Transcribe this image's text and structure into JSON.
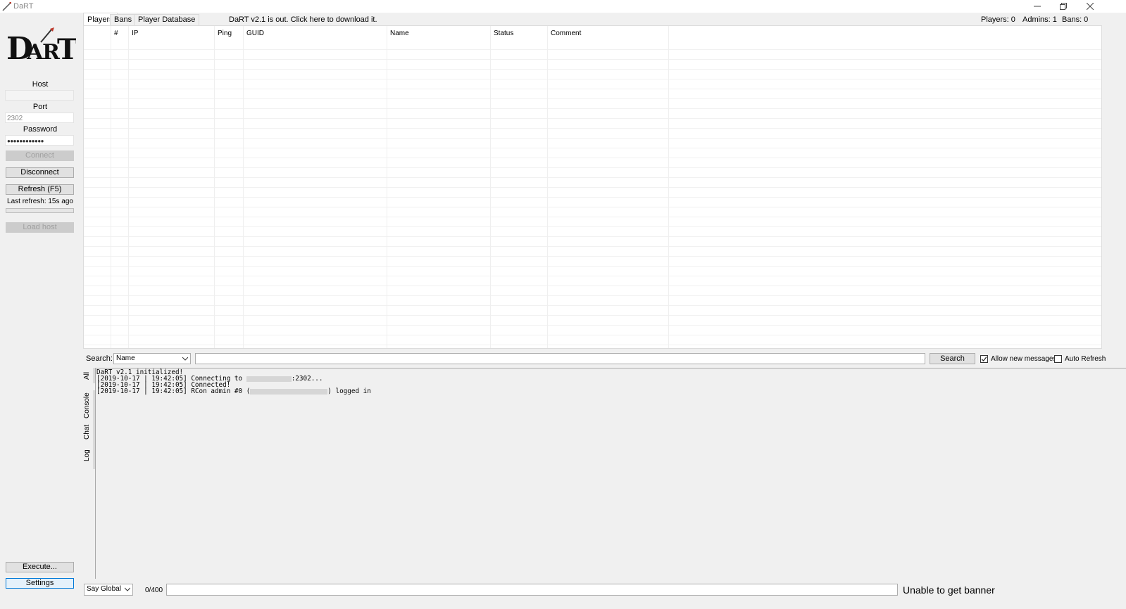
{
  "window": {
    "title": "DaRT"
  },
  "left_panel": {
    "host_label": "Host",
    "host_value": "",
    "port_label": "Port",
    "port_value": "2302",
    "password_label": "Password",
    "password_value": "●●●●●●●●●●●●",
    "connect_label": "Connect",
    "disconnect_label": "Disconnect",
    "refresh_label": "Refresh (F5)",
    "last_refresh": "Last refresh: 15s ago",
    "load_host_label": "Load host",
    "execute_label": "Execute...",
    "settings_label": "Settings"
  },
  "tabs": [
    {
      "label": "Players",
      "active": true
    },
    {
      "label": "Bans",
      "active": false
    },
    {
      "label": "Player Database",
      "active": false
    }
  ],
  "update_notice": "DaRT v2.1 is out. Click here to download it.",
  "counts": {
    "players": "Players: 0",
    "admins": "Admins: 1",
    "bans": "Bans: 0"
  },
  "grid": {
    "columns": [
      "#",
      "IP",
      "Ping",
      "GUID",
      "Name",
      "Status",
      "Comment"
    ],
    "rows": []
  },
  "search": {
    "label": "Search:",
    "field_option": "Name",
    "query": "",
    "button_label": "Search",
    "allow_new_messages_label": "Allow new messages",
    "allow_new_messages_checked": true,
    "auto_refresh_label": "Auto Refresh",
    "auto_refresh_checked": false
  },
  "log_tabs": [
    "All",
    "Console",
    "Chat",
    "Log"
  ],
  "log_lines": {
    "line1": "DaRT v2.1 initialized!",
    "line2_prefix": "[2019-10-17 | 19:42:05] Connecting to ",
    "line2_suffix": ":2302...",
    "line3": "[2019-10-17 | 19:42:05] Connected!",
    "line4_prefix": "[2019-10-17 | 19:42:05] RCon admin #0 (",
    "line4_suffix": ") logged in"
  },
  "bottom": {
    "say_option": "Say Global",
    "char_counter": "0/400",
    "message": "",
    "banner_status": "Unable to get banner"
  }
}
